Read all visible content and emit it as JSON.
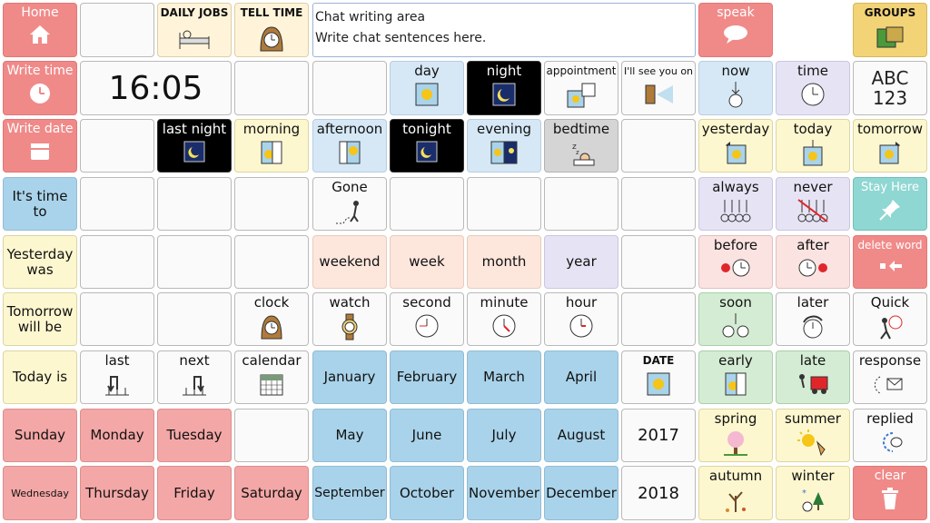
{
  "chat": {
    "line1": "Chat writing area",
    "line2": "Write chat sentences here."
  },
  "clock_display": "16:05",
  "cells": {
    "home": "Home",
    "daily_jobs": "DAILY JOBS",
    "tell_time": "TELL TIME",
    "speak": "speak",
    "groups": "GROUPS",
    "write_time": "Write time",
    "day": "day",
    "night": "night",
    "appointment": "appointment",
    "see_you_on": "I'll see you on",
    "now": "now",
    "time": "time",
    "abc": "ABC",
    "num": "123",
    "write_date": "Write date",
    "last_night": "last night",
    "morning": "morning",
    "afternoon": "afternoon",
    "tonight": "tonight",
    "evening": "evening",
    "bedtime": "bedtime",
    "yesterday": "yesterday",
    "today": "today",
    "tomorrow": "tomorrow",
    "its_time_to": "It's time to",
    "gone": "Gone",
    "always": "always",
    "never": "never",
    "stay_here": "Stay Here",
    "yesterday_was": "Yesterday was",
    "weekend": "weekend",
    "week": "week",
    "month": "month",
    "year": "year",
    "before": "before",
    "after": "after",
    "delete_word": "delete word",
    "tomorrow_will_be": "Tomorrow will be",
    "clock": "clock",
    "watch": "watch",
    "second": "second",
    "minute": "minute",
    "hour": "hour",
    "soon": "soon",
    "later": "later",
    "quick": "Quick",
    "today_is": "Today is",
    "last": "last",
    "next": "next",
    "calendar": "calendar",
    "january": "January",
    "february": "February",
    "march": "March",
    "april": "April",
    "date": "DATE",
    "early": "early",
    "late": "late",
    "response": "response",
    "sunday": "Sunday",
    "monday": "Monday",
    "tuesday": "Tuesday",
    "may": "May",
    "june": "June",
    "july": "July",
    "august": "August",
    "y2017": "2017",
    "spring": "spring",
    "summer": "summer",
    "replied": "replied",
    "wednesday": "Wednesday",
    "thursday": "Thursday",
    "friday": "Friday",
    "saturday": "Saturday",
    "september": "September",
    "october": "October",
    "november": "November",
    "december": "December",
    "y2018": "2018",
    "autumn": "autumn",
    "winter": "winter",
    "clear": "clear"
  },
  "colors": {
    "accent_red": "#f08a89",
    "month_blue": "#a9d3ea",
    "groups_gold": "#f2d477"
  }
}
